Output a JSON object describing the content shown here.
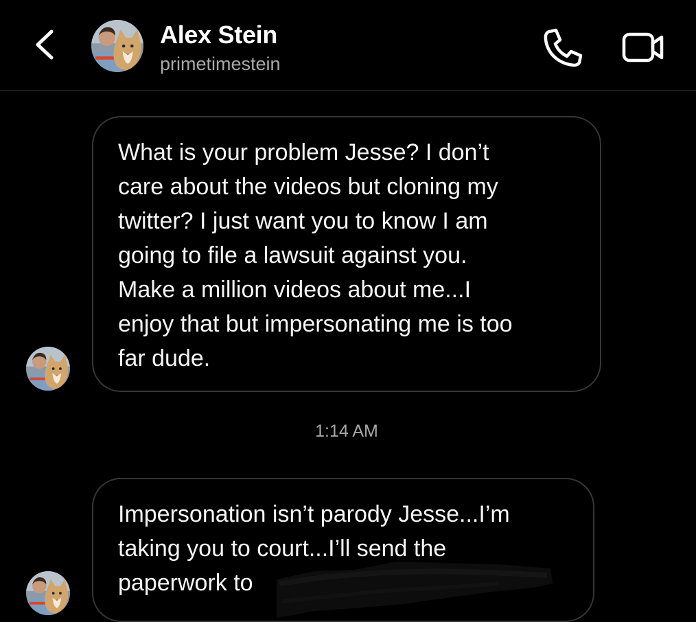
{
  "header": {
    "name": "Alex Stein",
    "handle": "primetimestein"
  },
  "icons": {
    "back": "chevron-left-icon",
    "call": "phone-icon",
    "video": "video-camera-icon"
  },
  "conversation": {
    "messages": [
      {
        "sender": "Alex Stein",
        "lines": [
          "What is your problem Jesse? I don’t",
          "care about the videos but cloning my",
          "twitter? I just want you to know I am",
          "going to file a lawsuit against you.",
          "Make a million videos about me...I",
          "enjoy that but impersonating me is too",
          "far dude."
        ]
      },
      {
        "sender": "Alex Stein",
        "lines": [
          "Impersonation isn’t parody Jesse...I’m",
          "taking you to court...I’ll send the",
          "paperwork to"
        ],
        "redacted": true
      }
    ],
    "timestamp": "1:14 AM"
  },
  "colors": {
    "background": "#000000",
    "text": "#ffffff",
    "secondary_text": "#a8a8a8",
    "bubble_border": "#363636",
    "divider": "#262626"
  }
}
